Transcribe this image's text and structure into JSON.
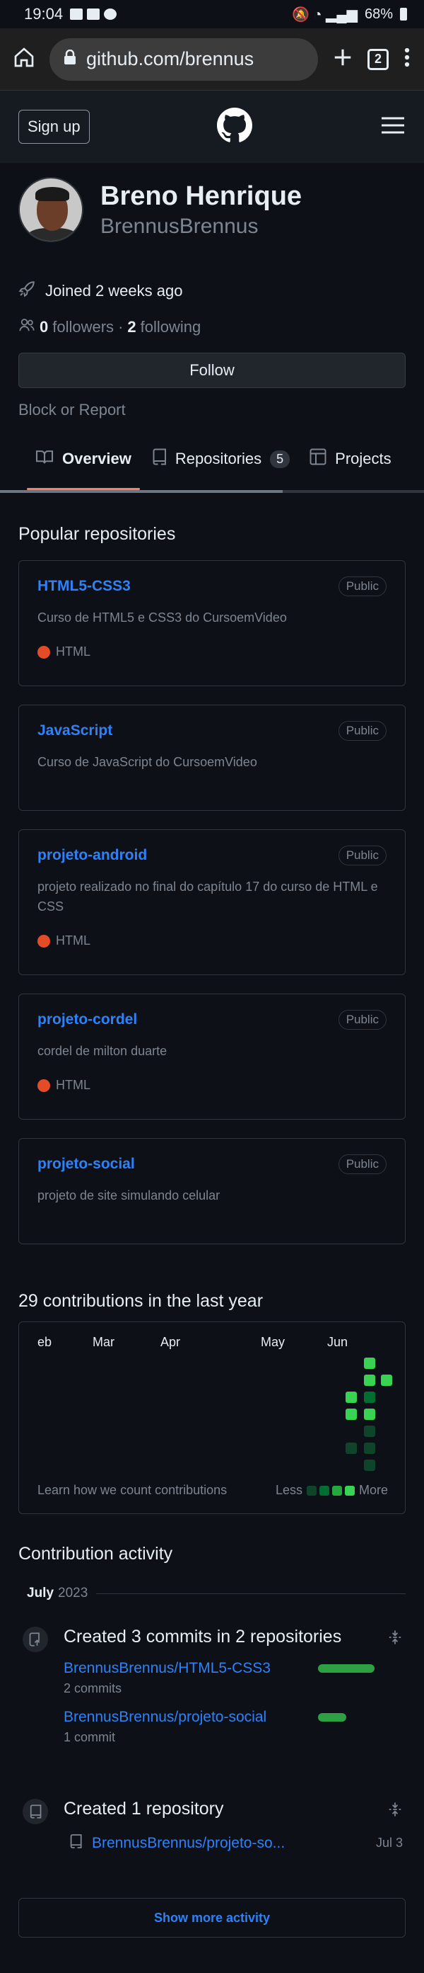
{
  "status_bar": {
    "time": "19:04",
    "battery": "68%"
  },
  "browser": {
    "url": "github.com/brennus",
    "tab_count": "2"
  },
  "header": {
    "signup_label": "Sign up"
  },
  "profile": {
    "name": "Breno Henrique",
    "login": "BrennusBrennus",
    "joined": "Joined 2 weeks ago",
    "followers_count": "0",
    "followers_label": "followers",
    "separator": "·",
    "following_count": "2",
    "following_label": "following",
    "follow_label": "Follow",
    "block_label": "Block or Report"
  },
  "tabs": [
    {
      "label": "Overview"
    },
    {
      "label": "Repositories",
      "count": "5"
    },
    {
      "label": "Projects"
    }
  ],
  "popular": {
    "title": "Popular repositories",
    "repos": [
      {
        "name": "HTML5-CSS3",
        "visibility": "Public",
        "description": "Curso de HTML5 e CSS3 do CursoemVideo",
        "language": "HTML"
      },
      {
        "name": "JavaScript",
        "visibility": "Public",
        "description": "Curso de JavaScript do CursoemVideo",
        "language": ""
      },
      {
        "name": "projeto-android",
        "visibility": "Public",
        "description": "projeto realizado no final do capítulo 17 do curso de HTML e CSS",
        "language": "HTML"
      },
      {
        "name": "projeto-cordel",
        "visibility": "Public",
        "description": "cordel de milton duarte",
        "language": "HTML"
      },
      {
        "name": "projeto-social",
        "visibility": "Public",
        "description": "projeto de site simulando celular",
        "language": ""
      }
    ]
  },
  "contributions": {
    "title": "29 contributions in the last year",
    "months": [
      "eb",
      "Mar",
      "Apr",
      "May",
      "Jun"
    ],
    "learn_label": "Learn how we count contributions",
    "less_label": "Less",
    "more_label": "More",
    "colors": {
      "l0": "#161b22",
      "l1": "#0e4429",
      "l2": "#006d32",
      "l3": "#26a641",
      "l4": "#39d353"
    }
  },
  "activity": {
    "title": "Contribution activity",
    "month": "July",
    "year": "2023",
    "commits_event": {
      "title": "Created 3 commits in 2 repositories",
      "items": [
        {
          "repo": "BrennusBrennus/HTML5-CSS3",
          "count": "2 commits",
          "share": 1.0
        },
        {
          "repo": "BrennusBrennus/projeto-social",
          "count": "1 commit",
          "share": 0.5
        }
      ]
    },
    "repo_event": {
      "title": "Created 1 repository",
      "repo": "BrennusBrennus/projeto-so...",
      "date": "Jul 3"
    },
    "show_more_label": "Show more activity"
  }
}
